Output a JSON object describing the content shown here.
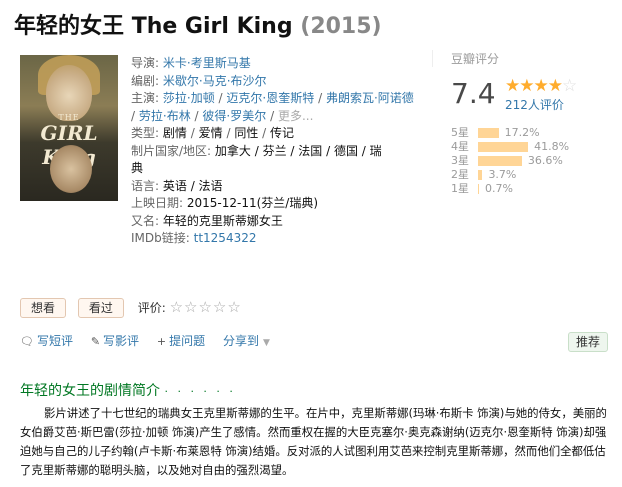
{
  "movie": {
    "title_cn": "年轻的女王",
    "title_en": "The Girl King",
    "year": "(2015)",
    "poster_title_small": "THE",
    "poster_title": "GIRL King"
  },
  "info": {
    "director_label": "导演:",
    "director": "米卡·考里斯马基",
    "writer_label": "编剧:",
    "writer": "米歇尔·马克·布沙尔",
    "cast_label": "主演:",
    "cast": [
      "莎拉·加顿",
      "迈克尔·恩奎斯特",
      "弗朗索瓦·阿诺德",
      "劳拉·布林",
      "彼得·罗美尔"
    ],
    "cast_more": "更多...",
    "genre_label": "类型:",
    "genres": [
      "剧情",
      "爱情",
      "同性",
      "传记"
    ],
    "country_label": "制片国家/地区:",
    "country_line1": "加拿大 / 芬兰 / 法国 / 德国 / 瑞",
    "country_line2": "典",
    "language_label": "语言:",
    "language": "英语 / 法语",
    "release_label": "上映日期:",
    "release": "2015-12-11(芬兰/瑞典)",
    "aka_label": "又名:",
    "aka": "年轻的克里斯蒂娜女王",
    "imdb_label": "IMDb链接:",
    "imdb": "tt1254322"
  },
  "rating": {
    "source_label": "豆瓣评分",
    "score": "7.4",
    "stars_on": "★★★★",
    "stars_off": "☆",
    "votes": "212人评价",
    "distribution": [
      {
        "label": "5星",
        "pct": "17.2%",
        "value": 17.2
      },
      {
        "label": "4星",
        "pct": "41.8%",
        "value": 41.8
      },
      {
        "label": "3星",
        "pct": "36.6%",
        "value": 36.6
      },
      {
        "label": "2星",
        "pct": "3.7%",
        "value": 3.7
      },
      {
        "label": "1星",
        "pct": "0.7%",
        "value": 0.7
      }
    ]
  },
  "actions": {
    "want_label": "想看",
    "seen_label": "看过",
    "rate_label": "评价:",
    "rate_stars": "☆☆☆☆☆"
  },
  "links": {
    "short_review": "写短评",
    "review": "写影评",
    "question": "提问题",
    "share": "分享到",
    "recommend": "推荐"
  },
  "synopsis": {
    "heading": "年轻的女王的剧情简介",
    "heading_dots": "· · · · · ·",
    "text": "影片讲述了十七世纪的瑞典女王克里斯蒂娜的生平。在片中，克里斯蒂娜(玛琳·布斯卡 饰演)与她的侍女，美丽的女伯爵艾芭·斯巴雷(莎拉·加顿 饰演)产生了感情。然而重权在握的大臣克塞尔·奥克森谢纳(迈克尔·恩奎斯特 饰演)却强迫她与自己的儿子约翰(卢卡斯·布莱恩特 饰演)结婚。反对派的人试图利用艾芭来控制克里斯蒂娜，然而他们全都低估了克里斯蒂娜的聪明头脑，以及她对自由的强烈渴望。"
  }
}
